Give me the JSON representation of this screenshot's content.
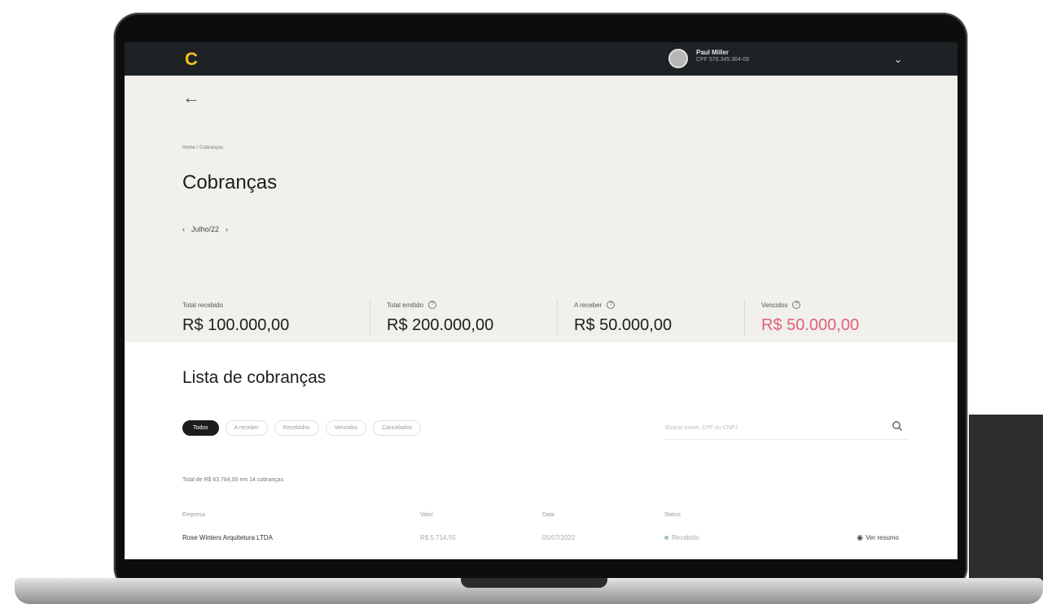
{
  "app": {
    "logo": "C",
    "user_name": "Paul Miller",
    "user_doc": "CPF 576.345.364-09"
  },
  "summary": {
    "breadcrumb": "Home / Cobranças",
    "title": "Cobranças",
    "month": "Julho/22",
    "stats": [
      {
        "label": "Total recebido",
        "value": "R$ 100.000,00",
        "help": false,
        "status": "normal"
      },
      {
        "label": "Total emitido",
        "value": "R$ 200.000,00",
        "help": true,
        "status": "normal"
      },
      {
        "label": "A receber",
        "value": "R$ 50.000,00",
        "help": true,
        "status": "normal"
      },
      {
        "label": "Vencidos",
        "value": "R$ 50.000,00",
        "help": true,
        "status": "danger"
      }
    ]
  },
  "list": {
    "title": "Lista de cobranças",
    "filters": [
      "Todos",
      "A receber",
      "Recebidos",
      "Vencidos",
      "Cancelados"
    ],
    "active_filter": "Todos",
    "search_placeholder": "Buscar nome, CPF ou CNPJ",
    "total_text": "Total de R$ 63.784,00 em 14 cobranças",
    "columns": [
      "Empresa",
      "Valor",
      "Data",
      "Status"
    ],
    "rows": [
      {
        "company": "Rose Winters Arquitetura LTDA",
        "value": "R$ 5.714,55",
        "date": "05/07/2022",
        "status": "Recebido",
        "action": "Ver resumo"
      }
    ]
  },
  "colors": {
    "topbar": "#1f2224",
    "accent": "#f2c318",
    "summary_bg": "#f1f0ec",
    "danger": "#e0607a"
  },
  "icons": [
    "back-arrow-icon",
    "chevron-down-icon",
    "chevron-left-icon",
    "chevron-right-icon",
    "help-icon",
    "search-icon",
    "eye-icon"
  ]
}
